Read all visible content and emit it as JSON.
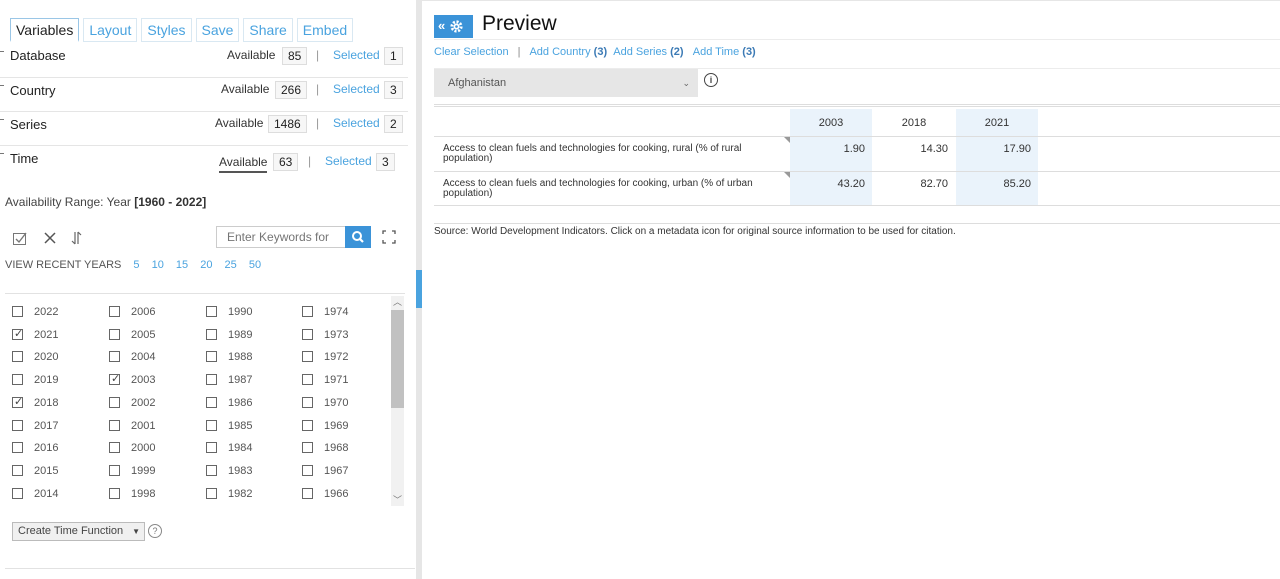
{
  "tabs": [
    "Variables",
    "Layout",
    "Styles",
    "Save",
    "Share",
    "Embed"
  ],
  "variables": [
    {
      "name": "Database",
      "available_label": "Available",
      "available": "85",
      "selected_label": "Selected",
      "selected": "1"
    },
    {
      "name": "Country",
      "available_label": "Available",
      "available": "266",
      "selected_label": "Selected",
      "selected": "3"
    },
    {
      "name": "Series",
      "available_label": "Available",
      "available": "1486",
      "selected_label": "Selected",
      "selected": "2"
    },
    {
      "name": "Time",
      "available_label": "Available",
      "available": "63",
      "selected_label": "Selected",
      "selected": "3"
    }
  ],
  "availability": {
    "label": "Availability Range: Year",
    "range": "[1960 - 2022]"
  },
  "search": {
    "placeholder": "Enter Keywords for"
  },
  "recent": {
    "label": "VIEW RECENT YEARS",
    "years": [
      "5",
      "10",
      "15",
      "20",
      "25",
      "50"
    ]
  },
  "years": {
    "columns": [
      [
        {
          "y": "2022",
          "c": false
        },
        {
          "y": "2021",
          "c": true
        },
        {
          "y": "2020",
          "c": false
        },
        {
          "y": "2019",
          "c": false
        },
        {
          "y": "2018",
          "c": true
        },
        {
          "y": "2017",
          "c": false
        },
        {
          "y": "2016",
          "c": false
        },
        {
          "y": "2015",
          "c": false
        },
        {
          "y": "2014",
          "c": false
        }
      ],
      [
        {
          "y": "2006",
          "c": false
        },
        {
          "y": "2005",
          "c": false
        },
        {
          "y": "2004",
          "c": false
        },
        {
          "y": "2003",
          "c": true
        },
        {
          "y": "2002",
          "c": false
        },
        {
          "y": "2001",
          "c": false
        },
        {
          "y": "2000",
          "c": false
        },
        {
          "y": "1999",
          "c": false
        },
        {
          "y": "1998",
          "c": false
        }
      ],
      [
        {
          "y": "1990",
          "c": false
        },
        {
          "y": "1989",
          "c": false
        },
        {
          "y": "1988",
          "c": false
        },
        {
          "y": "1987",
          "c": false
        },
        {
          "y": "1986",
          "c": false
        },
        {
          "y": "1985",
          "c": false
        },
        {
          "y": "1984",
          "c": false
        },
        {
          "y": "1983",
          "c": false
        },
        {
          "y": "1982",
          "c": false
        }
      ],
      [
        {
          "y": "1974",
          "c": false
        },
        {
          "y": "1973",
          "c": false
        },
        {
          "y": "1972",
          "c": false
        },
        {
          "y": "1971",
          "c": false
        },
        {
          "y": "1970",
          "c": false
        },
        {
          "y": "1969",
          "c": false
        },
        {
          "y": "1968",
          "c": false
        },
        {
          "y": "1967",
          "c": false
        },
        {
          "y": "1966",
          "c": false
        }
      ]
    ]
  },
  "time_function": {
    "label": "Create Time Function",
    "help": "?"
  },
  "preview": {
    "title": "Preview",
    "gear_label": "«",
    "actions": {
      "clear": "Clear Selection",
      "add_country": "Add Country",
      "add_country_count": "(3)",
      "add_series": "Add Series",
      "add_series_count": "(2)",
      "add_time": "Add Time",
      "add_time_count": "(3)"
    },
    "country": "Afghanistan",
    "info": "i"
  },
  "table": {
    "headers": [
      "2003",
      "2018",
      "2021"
    ],
    "rows": [
      {
        "series": "Access to clean fuels and technologies for cooking, rural (% of rural population)",
        "values": [
          "1.90",
          "14.30",
          "17.90"
        ]
      },
      {
        "series": "Access to clean fuels and technologies for cooking, urban (% of urban population)",
        "values": [
          "43.20",
          "82.70",
          "85.20"
        ]
      }
    ]
  },
  "source": "Source: World Development Indicators. Click on a metadata icon for original source information to be used for citation.",
  "colors": {
    "accent": "#3b93d8",
    "link": "#4aa3df",
    "shade": "#eaf3fb"
  }
}
